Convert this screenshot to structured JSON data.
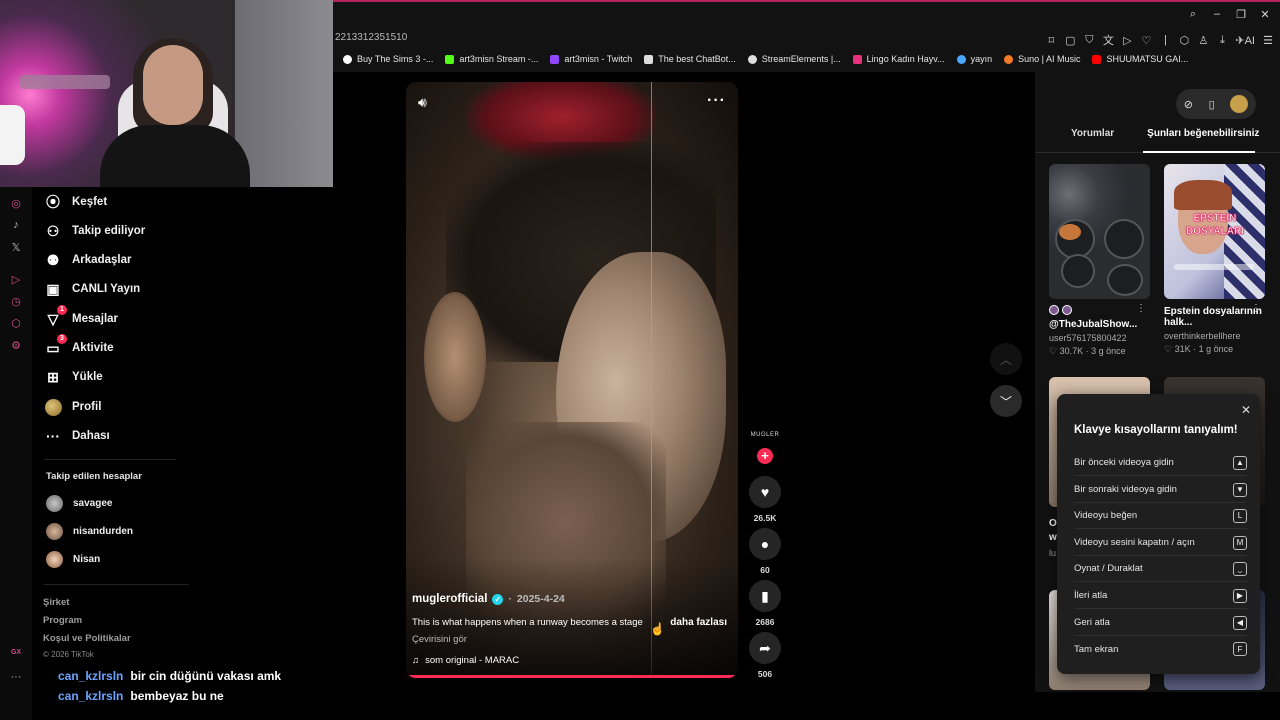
{
  "browser": {
    "url_fragment": "2213312351510",
    "bookmarks": [
      {
        "label": "Buy The Sims 3 -...",
        "color": "#ffffff"
      },
      {
        "label": "art3misn Stream -...",
        "color": "#53fc18"
      },
      {
        "label": "art3misn - Twitch",
        "color": "#9146ff"
      },
      {
        "label": "The best ChatBot...",
        "color": "#dddddd"
      },
      {
        "label": "StreamElements |...",
        "color": "#dddddd"
      },
      {
        "label": "Lingo Kadın Hayv...",
        "color": "#e8317a"
      },
      {
        "label": "yayın",
        "color": "#4aa8ff"
      },
      {
        "label": "Suno | AI Music",
        "color": "#f07a28"
      },
      {
        "label": "SHUUMATSU GAI...",
        "color": "#ff0000"
      }
    ]
  },
  "sidebar": {
    "nav": [
      {
        "label": "Keşfet",
        "icon": "compass-icon",
        "glyph": "⦿"
      },
      {
        "label": "Takip ediliyor",
        "icon": "user-follow-icon",
        "glyph": "👤"
      },
      {
        "label": "Arkadaşlar",
        "icon": "friends-icon",
        "glyph": "👥"
      },
      {
        "label": "CANLI Yayın",
        "icon": "live-icon",
        "glyph": "▣"
      },
      {
        "label": "Mesajlar",
        "icon": "messages-icon",
        "glyph": "✉",
        "badge": "1"
      },
      {
        "label": "Aktivite",
        "icon": "activity-icon",
        "glyph": "▭",
        "badge": "3"
      },
      {
        "label": "Yükle",
        "icon": "upload-icon",
        "glyph": "⊞"
      },
      {
        "label": "Profil",
        "icon": "profile-avatar",
        "glyph": ""
      },
      {
        "label": "Dahası",
        "icon": "more-icon",
        "glyph": "···"
      }
    ],
    "following_title": "Takip edilen hesaplar",
    "following": [
      {
        "name": "savagee"
      },
      {
        "name": "nisandurden"
      },
      {
        "name": "Nisan"
      }
    ],
    "footer": {
      "company": "Şirket",
      "program": "Program",
      "terms": "Koşul ve Politikalar",
      "copyright": "© 2026 TikTok"
    }
  },
  "chat": [
    {
      "user": "can_kzlrsln",
      "message": "bir cin düğünü vakası amk"
    },
    {
      "user": "can_kzlrsln",
      "message": "bembeyaz bu ne"
    }
  ],
  "video": {
    "author": "muglerofficial",
    "date": "2025-4-24",
    "description": "This is what happens when a runway becomes a stage",
    "more": "daha fazlası",
    "translate": "Çevirisini gör",
    "music": "som original - MARAC",
    "progress": 0.99,
    "brand": "MUGLER"
  },
  "actions": {
    "likes": "26.5K",
    "comments": "60",
    "saves": "2686",
    "shares": "506"
  },
  "right_panel": {
    "tabs": [
      "Yorumlar",
      "Şunları beğenebilirsiniz"
    ],
    "cards": [
      {
        "author": "@TheJubalShow...",
        "user": "user576175800422",
        "likes": "30.7K",
        "time": "3 g önce"
      },
      {
        "author": "Epstein dosyalarının halk...",
        "user": "overthinkerbellhere",
        "likes": "31K",
        "time": "1 g önce",
        "overlay": "EPSTEIN DOSYALARI"
      }
    ],
    "partial_texts": [
      "O",
      "w",
      "lu"
    ]
  },
  "shortcuts": {
    "title": "Klavye kısayollarını tanıyalım!",
    "items": [
      {
        "label": "Bir önceki videoya gidin",
        "key": "▲"
      },
      {
        "label": "Bir sonraki videoya gidin",
        "key": "▼"
      },
      {
        "label": "Videoyu beğen",
        "key": "L"
      },
      {
        "label": "Videoyu sesini kapatın / açın",
        "key": "M"
      },
      {
        "label": "Oynat / Duraklat",
        "key": "⎵"
      },
      {
        "label": "İleri atla",
        "key": "▶"
      },
      {
        "label": "Geri atla",
        "key": "◀"
      },
      {
        "label": "Tam ekran",
        "key": "F"
      }
    ]
  }
}
